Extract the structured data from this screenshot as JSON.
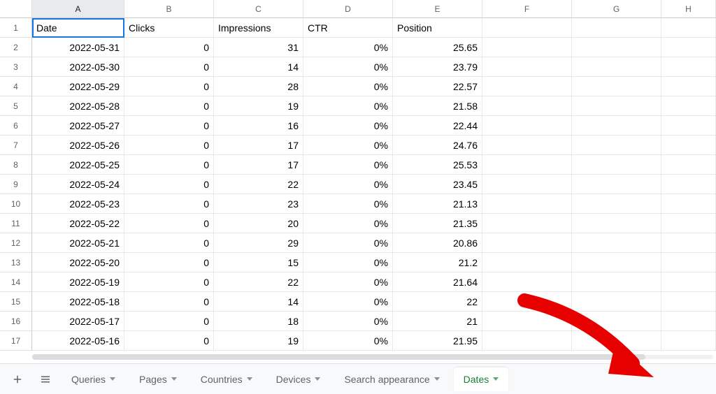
{
  "columns": [
    "A",
    "B",
    "C",
    "D",
    "E",
    "F",
    "G",
    "H"
  ],
  "headers": {
    "A": "Date",
    "B": "Clicks",
    "C": "Impressions",
    "D": "CTR",
    "E": "Position"
  },
  "rows": [
    {
      "n": 1,
      "A": "Date",
      "B": "Clicks",
      "C": "Impressions",
      "D": "CTR",
      "E": "Position"
    },
    {
      "n": 2,
      "A": "2022-05-31",
      "B": "0",
      "C": "31",
      "D": "0%",
      "E": "25.65"
    },
    {
      "n": 3,
      "A": "2022-05-30",
      "B": "0",
      "C": "14",
      "D": "0%",
      "E": "23.79"
    },
    {
      "n": 4,
      "A": "2022-05-29",
      "B": "0",
      "C": "28",
      "D": "0%",
      "E": "22.57"
    },
    {
      "n": 5,
      "A": "2022-05-28",
      "B": "0",
      "C": "19",
      "D": "0%",
      "E": "21.58"
    },
    {
      "n": 6,
      "A": "2022-05-27",
      "B": "0",
      "C": "16",
      "D": "0%",
      "E": "22.44"
    },
    {
      "n": 7,
      "A": "2022-05-26",
      "B": "0",
      "C": "17",
      "D": "0%",
      "E": "24.76"
    },
    {
      "n": 8,
      "A": "2022-05-25",
      "B": "0",
      "C": "17",
      "D": "0%",
      "E": "25.53"
    },
    {
      "n": 9,
      "A": "2022-05-24",
      "B": "0",
      "C": "22",
      "D": "0%",
      "E": "23.45"
    },
    {
      "n": 10,
      "A": "2022-05-23",
      "B": "0",
      "C": "23",
      "D": "0%",
      "E": "21.13"
    },
    {
      "n": 11,
      "A": "2022-05-22",
      "B": "0",
      "C": "20",
      "D": "0%",
      "E": "21.35"
    },
    {
      "n": 12,
      "A": "2022-05-21",
      "B": "0",
      "C": "29",
      "D": "0%",
      "E": "20.86"
    },
    {
      "n": 13,
      "A": "2022-05-20",
      "B": "0",
      "C": "15",
      "D": "0%",
      "E": "21.2"
    },
    {
      "n": 14,
      "A": "2022-05-19",
      "B": "0",
      "C": "22",
      "D": "0%",
      "E": "21.64"
    },
    {
      "n": 15,
      "A": "2022-05-18",
      "B": "0",
      "C": "14",
      "D": "0%",
      "E": "22"
    },
    {
      "n": 16,
      "A": "2022-05-17",
      "B": "0",
      "C": "18",
      "D": "0%",
      "E": "21"
    },
    {
      "n": 17,
      "A": "2022-05-16",
      "B": "0",
      "C": "19",
      "D": "0%",
      "E": "21.95"
    }
  ],
  "active_cell": "A1",
  "tabs": [
    {
      "label": "Queries"
    },
    {
      "label": "Pages"
    },
    {
      "label": "Countries"
    },
    {
      "label": "Devices"
    },
    {
      "label": "Search appearance"
    },
    {
      "label": "Dates",
      "active": true
    }
  ]
}
